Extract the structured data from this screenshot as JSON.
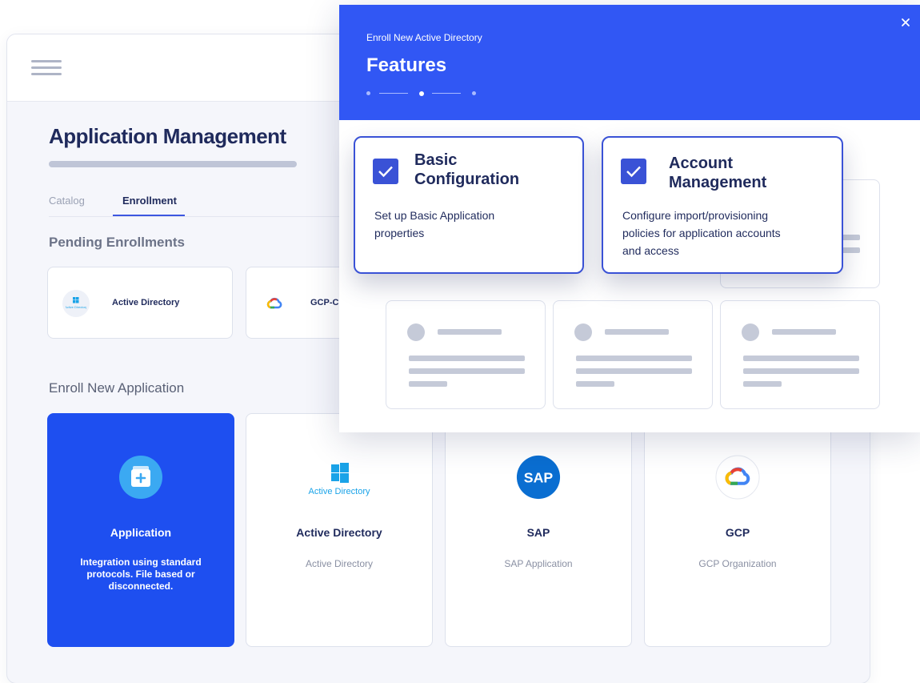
{
  "app": {
    "title": "Application Management",
    "tabs": [
      {
        "label": "Catalog",
        "active": false
      },
      {
        "label": "Enrollment",
        "active": true
      }
    ],
    "pending": {
      "heading": "Pending Enrollments",
      "items": [
        {
          "name": "Active Directory",
          "icon": "windows-icon"
        },
        {
          "name": "GCP-C",
          "icon": "google-cloud-icon"
        }
      ]
    },
    "enroll_new": {
      "heading": "Enroll New Application",
      "cards": [
        {
          "title": "Application",
          "subtitle": "Integration using standard protocols. File based or disconnected.",
          "icon": "add-application-icon",
          "selected": true
        },
        {
          "title": "Active Directory",
          "subtitle": "Active Directory",
          "icon": "windows-icon",
          "logo_text": "Active Directory"
        },
        {
          "title": "SAP",
          "subtitle": "SAP Application",
          "icon": "sap-logo",
          "logo_text": "SAP"
        },
        {
          "title": "GCP",
          "subtitle": "GCP Organization",
          "icon": "google-cloud-icon"
        }
      ]
    }
  },
  "modal": {
    "subtitle": "Enroll New Active Directory",
    "title": "Features",
    "steps": {
      "total": 3,
      "current": 2
    },
    "features": [
      {
        "title": "Basic Configuration",
        "title_lines": [
          "Basic",
          "Configuration"
        ],
        "description_lines": [
          "Set up Basic Application",
          "properties"
        ],
        "checked": true
      },
      {
        "title": "Account Management",
        "title_lines": [
          "Account",
          "Management"
        ],
        "description_lines": [
          "Configure import/provisioning",
          "policies for application accounts",
          "and access"
        ],
        "checked": true
      }
    ]
  },
  "colors": {
    "accent": "#3157f4",
    "selected_card": "#1e4ff0",
    "feature_border": "#3a52d6",
    "heading_text": "#1f2a5c",
    "placeholder": "#c5cad8"
  }
}
